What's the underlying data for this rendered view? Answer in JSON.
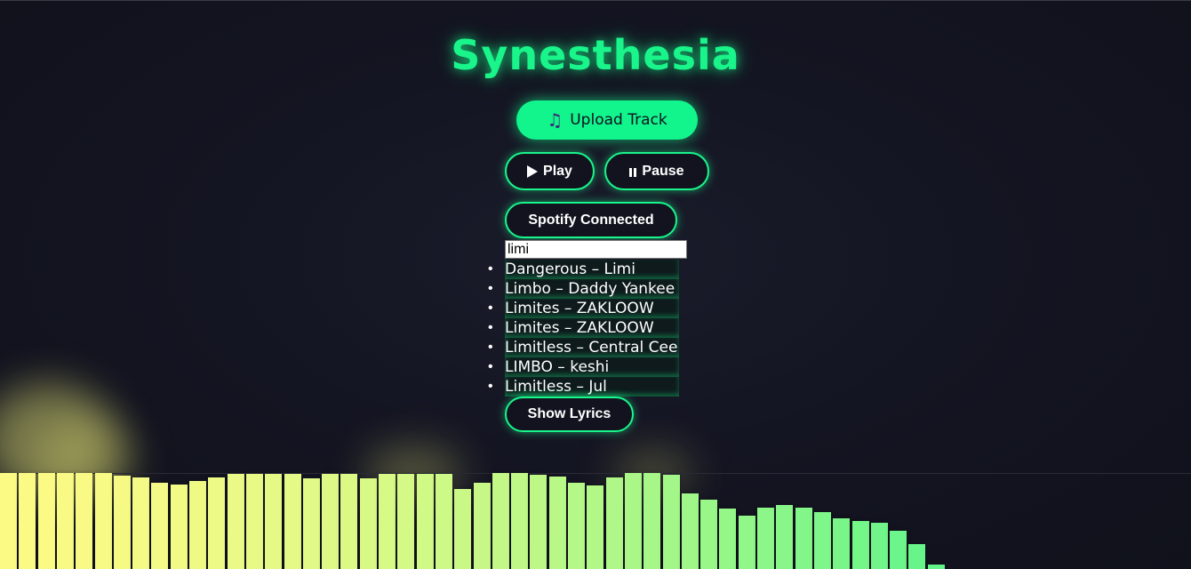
{
  "app": {
    "title": "Synesthesia"
  },
  "controls": {
    "upload_label": "Upload Track",
    "upload_icon": "music-note-icon",
    "play_label": "Play",
    "play_icon": "play-icon",
    "pause_label": "Pause",
    "pause_icon": "pause-icon",
    "spotify_label": "Spotify Connected",
    "lyrics_label": "Show Lyrics"
  },
  "search": {
    "value": "limi",
    "results": [
      "Dangerous – Limi",
      "Limbo – Daddy Yankee",
      "Limites – ZAKLOOW",
      "Limites – ZAKLOOW",
      "Limitless – Central Cee",
      "LIMBO – keshi",
      "Limitless – Jul"
    ]
  },
  "colors": {
    "accent": "#19f58a",
    "background": "#12131f",
    "bar_start": "#fbfa85",
    "bar_end": "#62f58a"
  },
  "visualizer": {
    "levels": [
      1.0,
      1.0,
      1.0,
      1.0,
      1.0,
      1.0,
      0.97,
      0.95,
      0.9,
      0.88,
      0.92,
      0.95,
      0.99,
      0.99,
      0.99,
      0.99,
      0.94,
      0.99,
      0.99,
      0.94,
      0.99,
      0.99,
      0.99,
      0.99,
      0.83,
      0.9,
      1.0,
      1.0,
      0.98,
      0.96,
      0.9,
      0.87,
      0.95,
      1.0,
      1.0,
      0.98,
      0.79,
      0.72,
      0.63,
      0.56,
      0.64,
      0.67,
      0.64,
      0.59,
      0.53,
      0.5,
      0.48,
      0.4,
      0.26,
      0.05
    ]
  }
}
